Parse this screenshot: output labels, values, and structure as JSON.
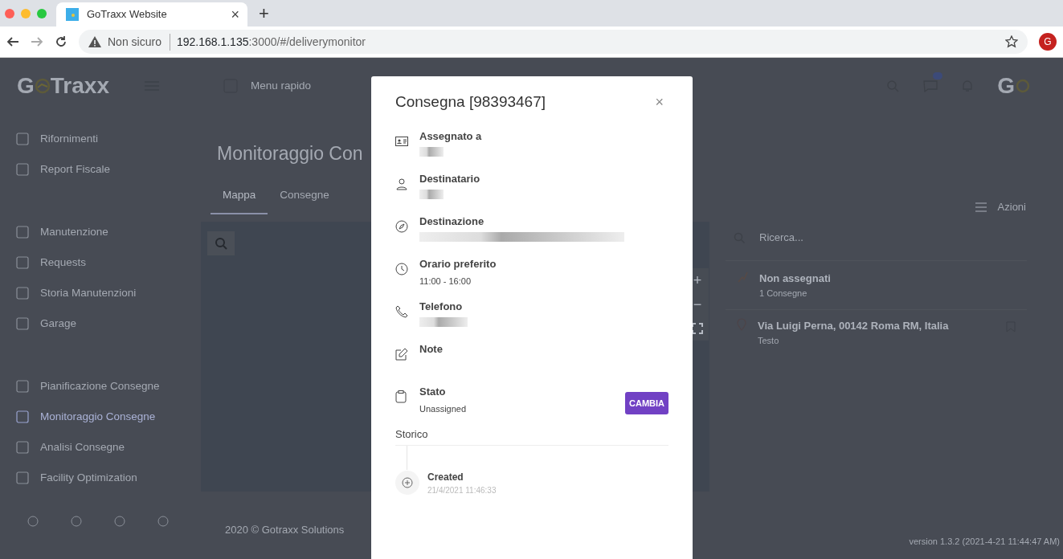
{
  "browser": {
    "tab_title": "GoTraxx Website",
    "tab_close": "×",
    "new_tab": "+",
    "security": "Non sicuro",
    "url_host": "192.168.1.135",
    "url_path": ":3000/#/deliverymonitor",
    "avatar": "G"
  },
  "app": {
    "logo_left": "G",
    "logo_right": "Traxx",
    "quick_menu": "Menu rapido",
    "notification_badge": true,
    "header_logo": "G",
    "sidebar_sections": [
      {
        "items": [
          {
            "label": "Rifornimenti",
            "selected": false
          },
          {
            "label": "Report Fiscale",
            "selected": false
          }
        ]
      },
      {
        "items": [
          {
            "label": "Manutenzione",
            "selected": false
          },
          {
            "label": "Requests",
            "selected": false
          },
          {
            "label": "Storia Manutenzioni",
            "selected": false
          },
          {
            "label": "Garage",
            "selected": false
          }
        ]
      },
      {
        "items": [
          {
            "label": "Pianificazione Consegne",
            "selected": false
          },
          {
            "label": "Monitoraggio Consegne",
            "selected": true
          },
          {
            "label": "Analisi Consegne",
            "selected": false
          },
          {
            "label": "Facility Optimization",
            "selected": false
          }
        ]
      }
    ],
    "page_title": "Monitoraggio Con",
    "tabs": [
      {
        "label": "Mappa",
        "selected": true
      },
      {
        "label": "Consegne",
        "selected": false
      }
    ],
    "actions": "Azioni",
    "map_controls": [
      "+",
      "−"
    ],
    "search": {
      "placeholder": "Ricerca..."
    },
    "groups": [
      {
        "title": "Non assegnati",
        "subtitle": "1 Consegne"
      }
    ],
    "deliveries": [
      {
        "address": "Via Luigi Perna, 00142 Roma RM, Italia",
        "note": "Testo"
      }
    ],
    "footer": "2020 © Gotraxx Solutions",
    "version": "version 1.3.2 (2021-4-21 11:44:47 AM)"
  },
  "modal": {
    "title": "Consegna [98393467]",
    "close": "×",
    "fields": [
      {
        "kind": "id-card",
        "label": "Assegnato a",
        "redacted": true
      },
      {
        "kind": "person",
        "label": "Destinatario",
        "redacted": true
      },
      {
        "kind": "compass",
        "label": "Destinazione",
        "redacted": true
      },
      {
        "kind": "clock",
        "label": "Orario preferito",
        "value": "11:00 - 16:00",
        "redacted": false
      },
      {
        "kind": "phone",
        "label": "Telefono",
        "redacted": true
      },
      {
        "kind": "edit",
        "label": "Note",
        "redacted": false
      }
    ],
    "status": {
      "label": "Stato",
      "value": "Unassigned",
      "button": "CAMBIA"
    },
    "history_title": "Storico",
    "history": [
      {
        "event": "Created",
        "time": "21/4/2021 11:46:33"
      }
    ]
  }
}
